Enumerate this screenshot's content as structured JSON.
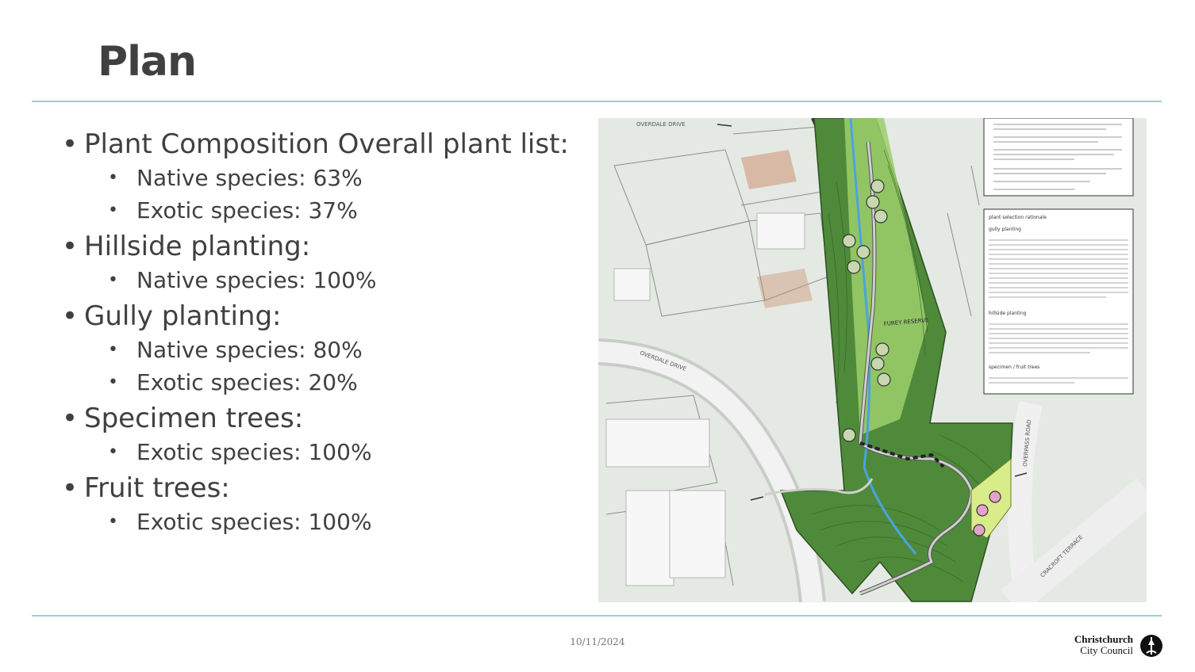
{
  "slide": {
    "title": "Plan",
    "date": "10/11/2024"
  },
  "bullets": [
    {
      "text": "Plant Composition Overall plant list:",
      "sub": [
        "Native species: 63%",
        "Exotic species: 37%"
      ]
    },
    {
      "text": "Hillside planting:",
      "sub": [
        "Native species: 100%"
      ]
    },
    {
      "text": "Gully planting:",
      "sub": [
        "Native species: 80%",
        "Exotic species: 20%"
      ]
    },
    {
      "text": "Specimen trees:",
      "sub": [
        "Exotic species: 100%"
      ]
    },
    {
      "text": "Fruit trees:",
      "sub": [
        "Exotic species: 100%"
      ]
    }
  ],
  "plan_image": {
    "street_labels": [
      "OVERDALE DRIVE",
      "OVERDALE DRIVE",
      "CRACROFT TERRACE",
      "OVERPASS ROAD"
    ],
    "reserve_label": "FUREY RESERVE",
    "legend_title": "plant selection rationale",
    "legend_sections": [
      "gully planting",
      "hillside planting",
      "specimen / fruit trees"
    ]
  },
  "logo": {
    "line1": "Christchurch",
    "line2": "City Council"
  },
  "colors": {
    "accent_rule": "#8fd4cf",
    "text": "#404040",
    "dark_green": "#4f8a3a",
    "light_green": "#9ccf6c"
  }
}
